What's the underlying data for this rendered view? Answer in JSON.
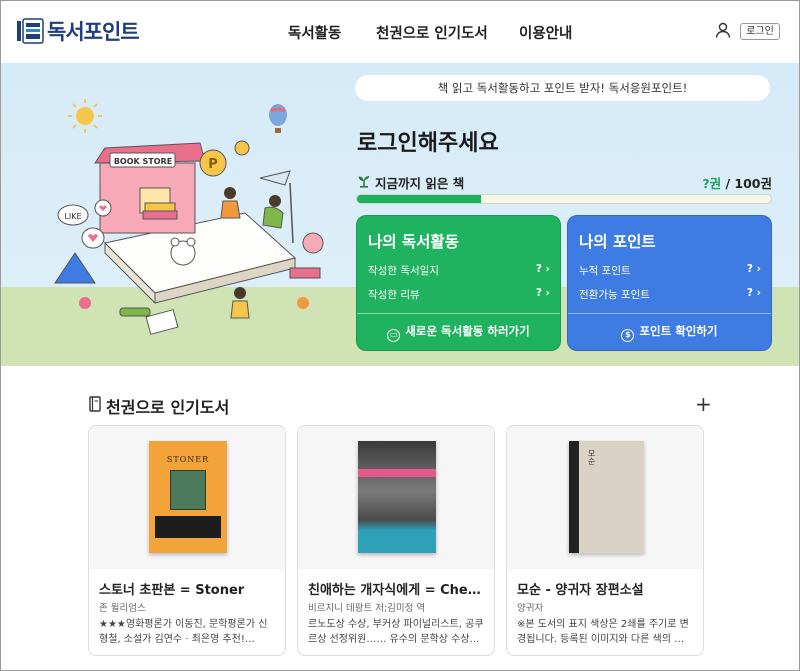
{
  "header": {
    "logo_text": "독서포인트",
    "nav": [
      "독서활동",
      "천권으로 인기도서",
      "이용안내"
    ],
    "login_label": "로그인"
  },
  "hero": {
    "banner": "책 읽고 독서활동하고 포인트 받자! 독서응원포인트!",
    "title": "로그인해주세요",
    "read_label": "지금까지 읽은 책",
    "read_count": "?권",
    "read_total": " / 100권",
    "progress": 0.3,
    "illustration_text": {
      "bookstore": "BOOK STORE",
      "like": "LIKE"
    },
    "my_activity": {
      "title": "나의 독서활동",
      "rows": [
        {
          "label": "작성한 독서일지",
          "value": "?"
        },
        {
          "label": "작성한 리뷰",
          "value": "?"
        }
      ],
      "action": "새로운 독서활동 하러가기"
    },
    "my_points": {
      "title": "나의 포인트",
      "rows": [
        {
          "label": "누적 포인트",
          "value": "?"
        },
        {
          "label": "전환가능 포인트",
          "value": "?"
        }
      ],
      "action": "포인트 확인하기"
    }
  },
  "popular": {
    "title": "천권으로 인기도서",
    "books": [
      {
        "title": "스토너 초판본 = Stoner",
        "author": "존 윌리엄스",
        "desc": "★★★영화평론가 이동진, 문학평론가 신형철, 소설가 김연수 · 최은영 추천!…",
        "cover_text": "STONER"
      },
      {
        "title": "친애하는 개자식에게 = Che…",
        "author": "비르지니 데팡트 저;김미정 역",
        "desc": "르노도상 수상, 부커상 파이널리스트, 공쿠르상 선정위원…… 유수의 문학상 수상…",
        "cover_text": ""
      },
      {
        "title": "모순 - 양귀자 장편소설",
        "author": "양귀자",
        "desc": "※본 도서의 표지 색상은 2쇄를 주기로 변경됩니다. 등록된 이미지와 다른 색의 …",
        "cover_text": "모순"
      }
    ]
  },
  "colors": {
    "brand": "#1f3f7a",
    "activity_green": "#1fb25f",
    "points_blue": "#3e7be2",
    "hero_sky": "#d6ebf8",
    "hero_grass": "#cfe3b4"
  }
}
